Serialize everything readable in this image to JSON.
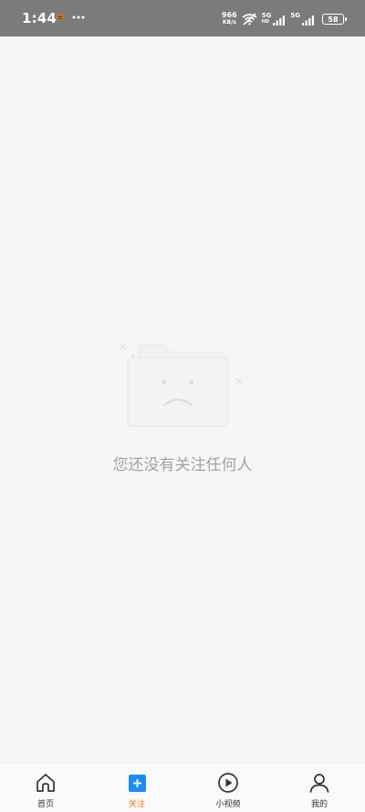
{
  "status_bar": {
    "time": "1:44",
    "network_speed_value": "966",
    "network_speed_unit": "KB/s",
    "signal_1_label": "5G",
    "signal_1_sub": "HD",
    "signal_2_label": "5G",
    "battery": "58",
    "icons": [
      "notification-icon",
      "more-dots-icon",
      "wifi-off-icon",
      "signal-icon",
      "battery-icon"
    ]
  },
  "empty_state": {
    "message": "您还没有关注任何人",
    "icon": "sad-folder-icon"
  },
  "tabbar": {
    "tabs": [
      {
        "label": "首页",
        "icon": "home-icon"
      },
      {
        "label": "关注",
        "icon": "plus-icon"
      },
      {
        "label": "小视频",
        "icon": "play-circle-icon"
      },
      {
        "label": "我的",
        "icon": "user-icon"
      }
    ],
    "active_index": 1
  },
  "colors": {
    "status_bar_bg": "#7b7b7b",
    "page_bg": "#f6f6f6",
    "accent_blue": "#1d8cf0",
    "active_label": "#f26d1e",
    "empty_text": "#a2a2a2"
  }
}
